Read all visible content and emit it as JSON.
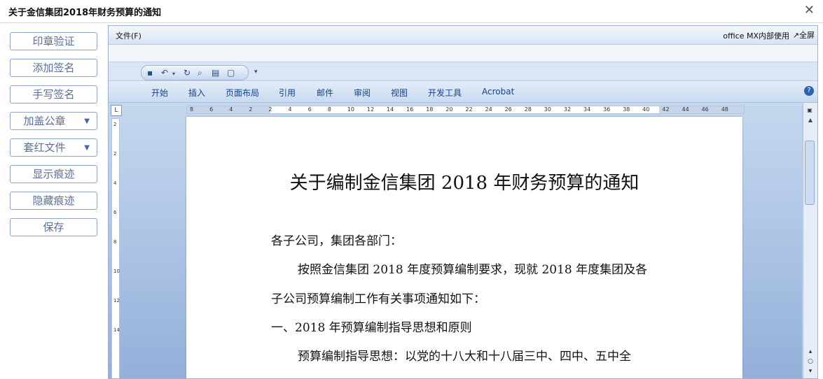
{
  "window": {
    "title": "关于金信集团2018年财务预算的通知",
    "close_icon": "✕"
  },
  "sidebar": {
    "buttons": [
      {
        "label": "印章验证"
      },
      {
        "label": "添加签名"
      },
      {
        "label": "手写签名"
      },
      {
        "label": "加盖公章",
        "dropdown": true
      },
      {
        "label": "套红文件",
        "dropdown": true
      },
      {
        "label": "显示痕迹"
      },
      {
        "label": "隐藏痕迹"
      },
      {
        "label": "保存"
      }
    ]
  },
  "word": {
    "menu": {
      "file": "文件(F)",
      "right_text": "office MX内部使用",
      "fullscreen": "↗全屏"
    },
    "ribbon_tabs": [
      "开始",
      "插入",
      "页面布局",
      "引用",
      "邮件",
      "审阅",
      "视图",
      "开发工具",
      "Acrobat"
    ],
    "help_icon": "?",
    "ruler": {
      "h_labels": [
        "8",
        "6",
        "4",
        "2",
        "2",
        "4",
        "6",
        "8",
        "10",
        "12",
        "14",
        "16",
        "18",
        "20",
        "22",
        "24",
        "26",
        "28",
        "30",
        "32",
        "34",
        "36",
        "38",
        "40",
        "42",
        "44",
        "46",
        "48"
      ],
      "v_labels": [
        "2",
        "2",
        "4",
        "6",
        "8",
        "10",
        "12",
        "14"
      ],
      "tab_stop_label": "L"
    },
    "document": {
      "title": "关于编制金信集团 2018 年财务预算的通知",
      "lines": [
        "各子公司，集团各部门：",
        "按照金信集团 2018 年度预算编制要求，现就 2018 年度集团及各",
        "子公司预算编制工作有关事项通知如下：",
        "一、2018 年预算编制指导思想和原则",
        "预算编制指导思想：以党的十八大和十八届三中、四中、五中全"
      ]
    }
  },
  "icons": {
    "save": "floppy-icon",
    "undo": "undo-icon",
    "redo": "redo-icon",
    "print_preview": "print-preview-icon",
    "print": "print-icon",
    "copy": "copy-icon",
    "customize": "customize-qat-icon"
  }
}
